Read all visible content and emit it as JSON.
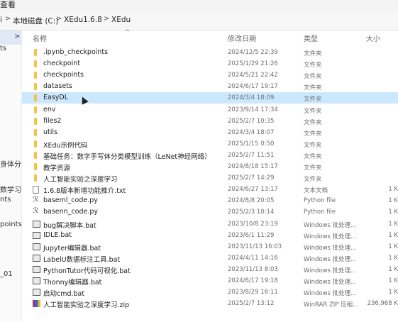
{
  "window": {
    "title_fragment": "查看"
  },
  "address": {
    "crumbs": [
      "i",
      "本地磁盘 (C:)",
      "XEdu1.6.8",
      "XEdu"
    ],
    "separator": ">"
  },
  "nav": {
    "items": [
      {
        "label": ">",
        "selected": true
      },
      {
        "label": "ts"
      },
      {
        "label": "身体分"
      },
      {
        "label": "数学习"
      },
      {
        "label": "nts"
      },
      {
        "label": "points"
      },
      {
        "label": "_01"
      }
    ]
  },
  "columns": {
    "name": "名称",
    "date": "修改日期",
    "type": "类型",
    "size": "大小"
  },
  "files": [
    {
      "name": ".ipynb_checkpoints",
      "date": "2024/12/5 22:39",
      "type": "文件夹",
      "size": "",
      "kind": "folder"
    },
    {
      "name": "checkpoint",
      "date": "2025/1/29 21:26",
      "type": "文件夹",
      "size": "",
      "kind": "folder"
    },
    {
      "name": "checkpoints",
      "date": "2024/5/21 22:42",
      "type": "文件夹",
      "size": "",
      "kind": "folder"
    },
    {
      "name": "datasets",
      "date": "2024/6/17 19:17",
      "type": "文件夹",
      "size": "",
      "kind": "folder"
    },
    {
      "name": "EasyDL",
      "date": "2024/3/4 18:09",
      "type": "文件夹",
      "size": "",
      "kind": "folder",
      "selected": true
    },
    {
      "name": "env",
      "date": "2023/9/14 17:34",
      "type": "文件夹",
      "size": "",
      "kind": "folder"
    },
    {
      "name": "files2",
      "date": "2025/2/7 10:35",
      "type": "文件夹",
      "size": "",
      "kind": "folder"
    },
    {
      "name": "utils",
      "date": "2024/3/4 18:07",
      "type": "文件夹",
      "size": "",
      "kind": "folder"
    },
    {
      "name": "XEdu示例代码",
      "date": "2025/1/15 0:50",
      "type": "文件夹",
      "size": "",
      "kind": "folder"
    },
    {
      "name": "基础任务：数字手写体分类模型训练（LeNet神经网络）",
      "date": "2025/2/7 11:51",
      "type": "文件夹",
      "size": "",
      "kind": "folder"
    },
    {
      "name": "教学资源",
      "date": "2024/8/18 15:17",
      "type": "文件夹",
      "size": "",
      "kind": "folder"
    },
    {
      "name": "人工智能实验之深度学习",
      "date": "2025/2/7 14:29",
      "type": "文件夹",
      "size": "",
      "kind": "folder"
    },
    {
      "name": "1.6.8版本新增功能推介.txt",
      "date": "2024/6/27 13:17",
      "type": "文本文档",
      "size": "1 K",
      "kind": "txt"
    },
    {
      "name": "baseml_code.py",
      "date": "2024/8/8 20:05",
      "type": "Python file",
      "size": "1 K",
      "kind": "py"
    },
    {
      "name": "basenn_code.py",
      "date": "2025/2/3 10:14",
      "type": "Python file",
      "size": "1 K",
      "kind": "py"
    },
    {
      "name": "bug解决脚本.bat",
      "date": "2023/10/8 23:19",
      "type": "Windows 批处理...",
      "size": "1 K",
      "kind": "bat"
    },
    {
      "name": "IDLE.bat",
      "date": "2023/6/1 11:29",
      "type": "Windows 批处理...",
      "size": "1 K",
      "kind": "bat"
    },
    {
      "name": "Jupyter编辑器.bat",
      "date": "2023/11/13 16:03",
      "type": "Windows 批处理...",
      "size": "1 K",
      "kind": "bat"
    },
    {
      "name": "LabelU数据标注工具.bat",
      "date": "2024/4/11 14:16",
      "type": "Windows 批处理...",
      "size": "1 K",
      "kind": "bat"
    },
    {
      "name": "PythonTutor代码可视化.bat",
      "date": "2023/11/13 8:03",
      "type": "Windows 批处理...",
      "size": "1 K",
      "kind": "bat"
    },
    {
      "name": "Thonny编辑器.bat",
      "date": "2024/6/17 19:18",
      "type": "Windows 批处理...",
      "size": "1 K",
      "kind": "bat"
    },
    {
      "name": "启动cmd.bat",
      "date": "2023/8/29 16:11",
      "type": "Windows 批处理...",
      "size": "1 K",
      "kind": "bat"
    },
    {
      "name": "人工智能实验之深度学习.zip",
      "date": "2025/2/7 13:12",
      "type": "WinRAR ZIP 压缩...",
      "size": "236,968 K",
      "kind": "zip"
    }
  ]
}
